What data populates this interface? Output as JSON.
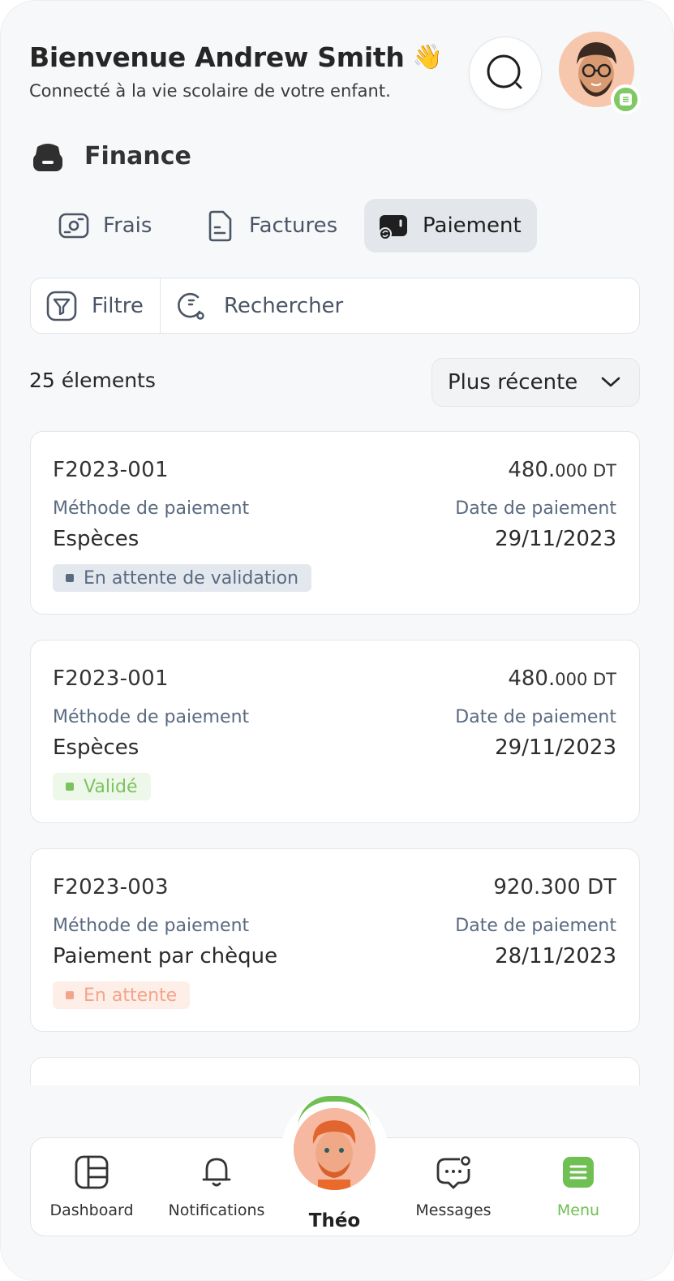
{
  "header": {
    "greeting": "Bienvenue Andrew Smith",
    "wave_emoji": "👋",
    "subtitle": "Connecté à la vie scolaire de votre enfant."
  },
  "section": {
    "title": "Finance"
  },
  "tabs": [
    {
      "label": "Frais",
      "icon": "wallet-icon",
      "active": false
    },
    {
      "label": "Factures",
      "icon": "document-icon",
      "active": false
    },
    {
      "label": "Paiement",
      "icon": "payment-icon",
      "active": true
    }
  ],
  "filter": {
    "label": "Filtre",
    "search_placeholder": "Rechercher"
  },
  "list_meta": {
    "count_text": "25 élements",
    "sort_label": "Plus récente"
  },
  "payments": [
    {
      "ref": "F2023-001",
      "amount_main": "480.",
      "amount_dec": "000 DT",
      "method_label": "Méthode de paiement",
      "method": "Espèces",
      "date_label": "Date de paiement",
      "date": "29/11/2023",
      "status": "En attente de validation",
      "status_color": "#5a6a80",
      "status_bg": "#e3e8ee"
    },
    {
      "ref": "F2023-001",
      "amount_main": "480.",
      "amount_dec": "000 DT",
      "method_label": "Méthode de paiement",
      "method": "Espèces",
      "date_label": "Date de paiement",
      "date": "29/11/2023",
      "status": "Validé",
      "status_color": "#7cc35f",
      "status_bg": "#eef8ea"
    },
    {
      "ref": "F2023-003",
      "amount_main": "920.300 DT",
      "amount_dec": "",
      "method_label": "Méthode de paiement",
      "method": "Paiement par chèque",
      "date_label": "Date de paiement",
      "date": "28/11/2023",
      "status": "En attente",
      "status_color": "#f2a58a",
      "status_bg": "#fdeee8"
    }
  ],
  "bottom_nav": {
    "dashboard": "Dashboard",
    "notifications": "Notifications",
    "child_name": "Théo",
    "messages": "Messages",
    "menu": "Menu"
  },
  "colors": {
    "accent_green": "#6fbf52",
    "text_muted": "#5a6a80"
  }
}
